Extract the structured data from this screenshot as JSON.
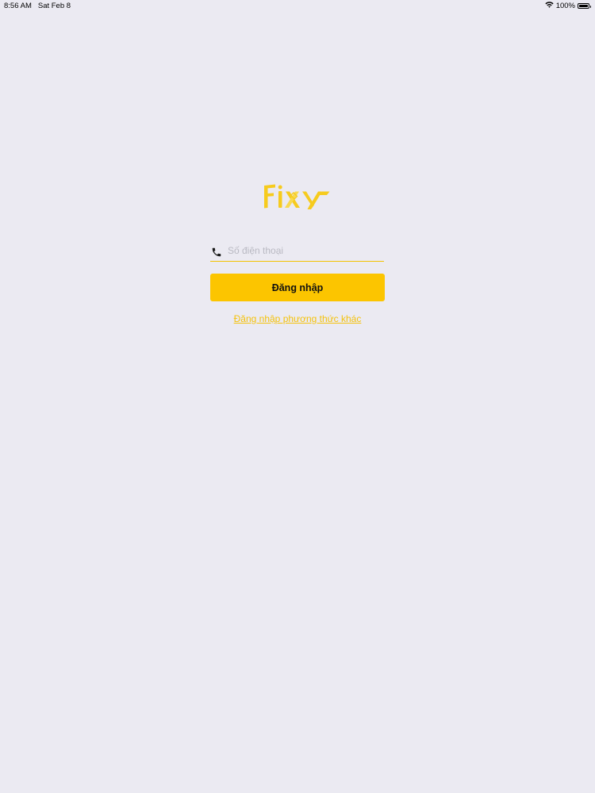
{
  "status_bar": {
    "time": "8:56 AM",
    "date": "Sat Feb 8",
    "battery": "100%",
    "wifi_icon": "wifi-icon",
    "battery_icon": "battery-icon"
  },
  "logo": {
    "text": "Fixy",
    "color": "#F6CB1E"
  },
  "login_form": {
    "phone_icon": "phone-icon",
    "phone_placeholder": "Số điện thoại",
    "phone_value": "",
    "login_button_label": "Đăng nhập",
    "alternate_login_link": "Đăng nhập phương thức khác"
  },
  "colors": {
    "background": "#EBEAF2",
    "accent": "#FCC500",
    "link": "#F4C20D"
  }
}
